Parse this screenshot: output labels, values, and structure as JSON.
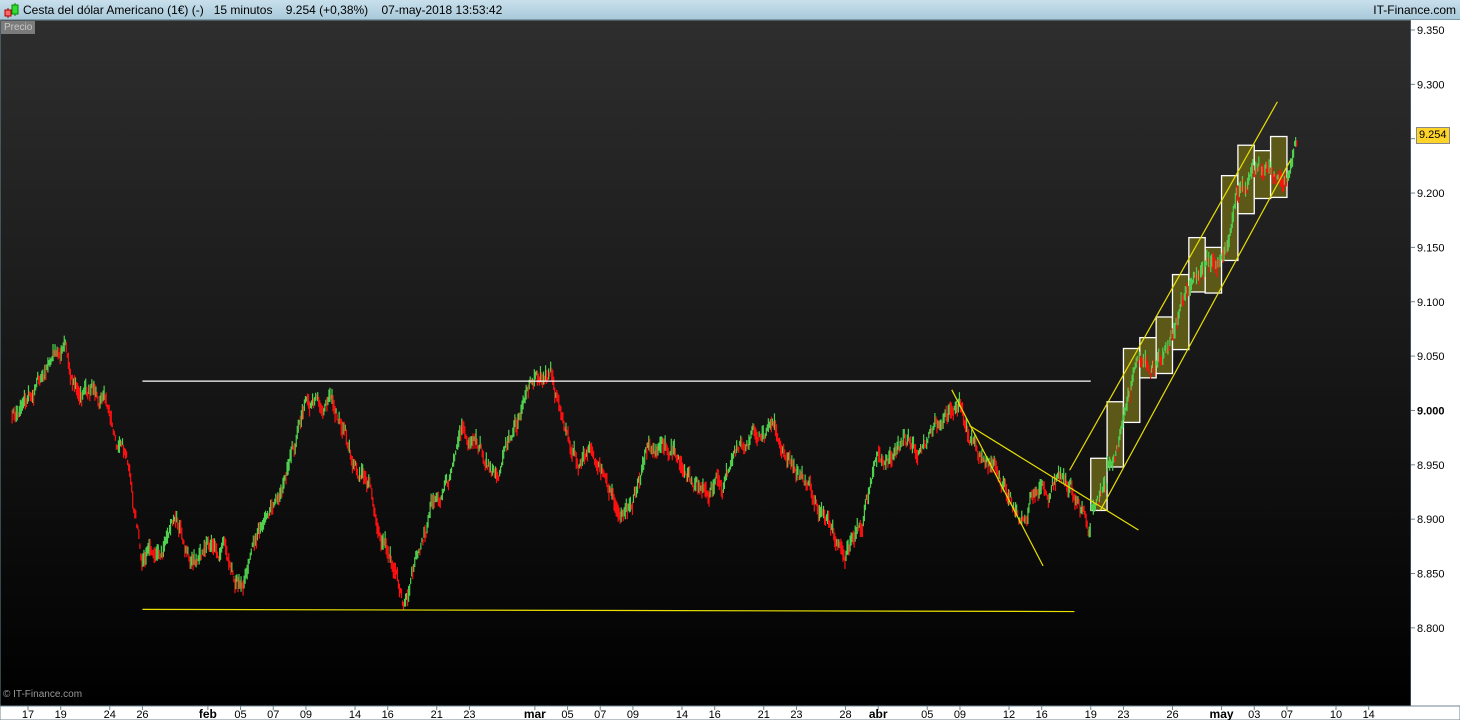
{
  "header": {
    "title": "Cesta del dólar Americano (1€) (-)   15 minutos    9.254 (+0,38%)    07-may-2018 13:53:42",
    "brand": "IT-Finance.com",
    "icon": "candlestick-icon"
  },
  "panel_label": "Precio",
  "watermark": "© IT-Finance.com",
  "last_price_tag": "9.254",
  "colors": {
    "up": "#4fd14f",
    "down": "#ff1010",
    "lines_yellow": "#e8e000",
    "lines_white": "#ffffff",
    "box_fill": "#5c5818",
    "price_tag": "#ffd42a"
  },
  "chart_data": {
    "type": "candlestick",
    "interval": "15 minutos",
    "ylim": [
      8.75,
      9.36
    ],
    "y_ticks": [
      "9.350",
      "9.300",
      "9.250",
      "9.200",
      "9.150",
      "9.100",
      "9.050",
      "9.000",
      "8.950",
      "8.900",
      "8.850",
      "8.800"
    ],
    "x_ticks": [
      {
        "label": "17",
        "date": "2018-01-17"
      },
      {
        "label": "19",
        "date": "2018-01-19"
      },
      {
        "label": "24",
        "date": "2018-01-24"
      },
      {
        "label": "26",
        "date": "2018-01-26"
      },
      {
        "label": "feb",
        "date": "2018-02-01",
        "bold": true
      },
      {
        "label": "05",
        "date": "2018-02-05"
      },
      {
        "label": "07",
        "date": "2018-02-07"
      },
      {
        "label": "09",
        "date": "2018-02-09"
      },
      {
        "label": "14",
        "date": "2018-02-14"
      },
      {
        "label": "16",
        "date": "2018-02-16"
      },
      {
        "label": "21",
        "date": "2018-02-21"
      },
      {
        "label": "23",
        "date": "2018-02-23"
      },
      {
        "label": "mar",
        "date": "2018-03-01",
        "bold": true
      },
      {
        "label": "05",
        "date": "2018-03-05"
      },
      {
        "label": "07",
        "date": "2018-03-07"
      },
      {
        "label": "09",
        "date": "2018-03-09"
      },
      {
        "label": "14",
        "date": "2018-03-14"
      },
      {
        "label": "16",
        "date": "2018-03-16"
      },
      {
        "label": "21",
        "date": "2018-03-21"
      },
      {
        "label": "23",
        "date": "2018-03-23"
      },
      {
        "label": "28",
        "date": "2018-03-28"
      },
      {
        "label": "abr",
        "date": "2018-04-02",
        "bold": true
      },
      {
        "label": "05",
        "date": "2018-04-05"
      },
      {
        "label": "09",
        "date": "2018-04-09"
      },
      {
        "label": "12",
        "date": "2018-04-12"
      },
      {
        "label": "16",
        "date": "2018-04-16"
      },
      {
        "label": "19",
        "date": "2018-04-19"
      },
      {
        "label": "23",
        "date": "2018-04-23"
      },
      {
        "label": "26",
        "date": "2018-04-26"
      },
      {
        "label": "may",
        "date": "2018-05-01",
        "bold": true
      },
      {
        "label": "03",
        "date": "2018-05-03"
      },
      {
        "label": "07",
        "date": "2018-05-07"
      },
      {
        "label": "10",
        "date": "2018-05-10"
      },
      {
        "label": "14",
        "date": "2018-05-14"
      }
    ],
    "daily_close": [
      [
        "2018-01-15",
        9.0
      ],
      [
        "2018-01-16",
        9.01
      ],
      [
        "2018-01-17",
        9.03
      ],
      [
        "2018-01-18",
        9.05
      ],
      [
        "2018-01-19",
        9.02
      ],
      [
        "2018-01-22",
        9.02
      ],
      [
        "2018-01-23",
        9.0
      ],
      [
        "2018-01-24",
        8.96
      ],
      [
        "2018-01-25",
        8.86
      ],
      [
        "2018-01-26",
        8.87
      ],
      [
        "2018-01-29",
        8.9
      ],
      [
        "2018-01-30",
        8.86
      ],
      [
        "2018-01-31",
        8.88
      ],
      [
        "2018-02-01",
        8.88
      ],
      [
        "2018-02-02",
        8.84
      ],
      [
        "2018-02-05",
        8.88
      ],
      [
        "2018-02-06",
        8.91
      ],
      [
        "2018-02-07",
        8.95
      ],
      [
        "2018-02-08",
        9.01
      ],
      [
        "2018-02-09",
        9.0
      ],
      [
        "2018-02-12",
        8.99
      ],
      [
        "2018-02-13",
        8.95
      ],
      [
        "2018-02-14",
        8.93
      ],
      [
        "2018-02-15",
        8.87
      ],
      [
        "2018-02-16",
        8.82
      ],
      [
        "2018-02-19",
        8.87
      ],
      [
        "2018-02-20",
        8.92
      ],
      [
        "2018-02-21",
        8.95
      ],
      [
        "2018-02-22",
        8.97
      ],
      [
        "2018-02-23",
        8.95
      ],
      [
        "2018-02-26",
        8.95
      ],
      [
        "2018-02-27",
        8.99
      ],
      [
        "2018-02-28",
        9.03
      ],
      [
        "2018-03-01",
        9.04
      ],
      [
        "2018-03-02",
        8.98
      ],
      [
        "2018-03-05",
        8.96
      ],
      [
        "2018-03-06",
        8.95
      ],
      [
        "2018-03-07",
        8.91
      ],
      [
        "2018-03-08",
        8.91
      ],
      [
        "2018-03-09",
        8.97
      ],
      [
        "2018-03-12",
        8.97
      ],
      [
        "2018-03-13",
        8.95
      ],
      [
        "2018-03-14",
        8.93
      ],
      [
        "2018-03-15",
        8.93
      ],
      [
        "2018-03-16",
        8.95
      ],
      [
        "2018-03-19",
        8.97
      ],
      [
        "2018-03-20",
        8.98
      ],
      [
        "2018-03-21",
        8.97
      ],
      [
        "2018-03-22",
        8.94
      ],
      [
        "2018-03-23",
        8.92
      ],
      [
        "2018-03-26",
        8.9
      ],
      [
        "2018-03-27",
        8.86
      ],
      [
        "2018-03-28",
        8.89
      ],
      [
        "2018-03-29",
        8.96
      ],
      [
        "2018-04-02",
        8.96
      ],
      [
        "2018-04-03",
        8.97
      ],
      [
        "2018-04-04",
        8.97
      ],
      [
        "2018-04-05",
        8.99
      ],
      [
        "2018-04-06",
        9.01
      ],
      [
        "2018-04-09",
        8.97
      ],
      [
        "2018-04-10",
        8.95
      ],
      [
        "2018-04-11",
        8.92
      ],
      [
        "2018-04-12",
        8.9
      ],
      [
        "2018-04-13",
        8.93
      ],
      [
        "2018-04-16",
        8.94
      ],
      [
        "2018-04-17",
        8.92
      ],
      [
        "2018-04-18",
        8.89
      ],
      [
        "2018-04-19",
        8.93
      ],
      [
        "2018-04-20",
        8.99
      ],
      [
        "2018-04-23",
        9.05
      ],
      [
        "2018-04-24",
        9.04
      ],
      [
        "2018-04-25",
        9.07
      ],
      [
        "2018-04-26",
        9.11
      ],
      [
        "2018-04-27",
        9.13
      ],
      [
        "2018-04-30",
        9.14
      ],
      [
        "2018-05-01",
        9.2
      ],
      [
        "2018-05-02",
        9.22
      ],
      [
        "2018-05-03",
        9.22
      ],
      [
        "2018-05-04",
        9.21
      ],
      [
        "2018-05-07",
        9.254
      ]
    ],
    "last_session_end": "2018-05-07 13:53",
    "range_boxes": [
      [
        "2018-04-19",
        8.908,
        8.956
      ],
      [
        "2018-04-20",
        8.948,
        9.008
      ],
      [
        "2018-04-23",
        8.989,
        9.057
      ],
      [
        "2018-04-24",
        9.03,
        9.067
      ],
      [
        "2018-04-25",
        9.034,
        9.086
      ],
      [
        "2018-04-26",
        9.056,
        9.125
      ],
      [
        "2018-04-27",
        9.109,
        9.159
      ],
      [
        "2018-04-30",
        9.108,
        9.15
      ],
      [
        "2018-05-01",
        9.138,
        9.216
      ],
      [
        "2018-05-02",
        9.181,
        9.244
      ],
      [
        "2018-05-03",
        9.195,
        9.239
      ],
      [
        "2018-05-04",
        9.196,
        9.252
      ]
    ],
    "trend_lines": [
      {
        "color": "white",
        "from": [
          "2018-01-26 00:00",
          9.027
        ],
        "to": [
          "2018-04-19 00:00",
          9.027
        ]
      },
      {
        "color": "yellow",
        "from": [
          "2018-01-26 00:00",
          8.817
        ],
        "to": [
          "2018-04-18 00:00",
          8.815
        ]
      },
      {
        "color": "yellow",
        "from": [
          "2018-04-06 12:00",
          9.019
        ],
        "to": [
          "2018-04-16 02:00",
          8.857
        ]
      },
      {
        "color": "yellow",
        "from": [
          "2018-04-09 14:00",
          8.986
        ],
        "to": [
          "2018-04-23 22:00",
          8.89
        ]
      },
      {
        "color": "yellow",
        "from": [
          "2018-04-17 17:00",
          8.945
        ],
        "to": [
          "2018-05-04 10:00",
          9.284
        ]
      },
      {
        "color": "yellow",
        "from": [
          "2018-04-19 14:00",
          8.908
        ],
        "to": [
          "2018-05-07 05:00",
          9.23
        ]
      }
    ]
  }
}
